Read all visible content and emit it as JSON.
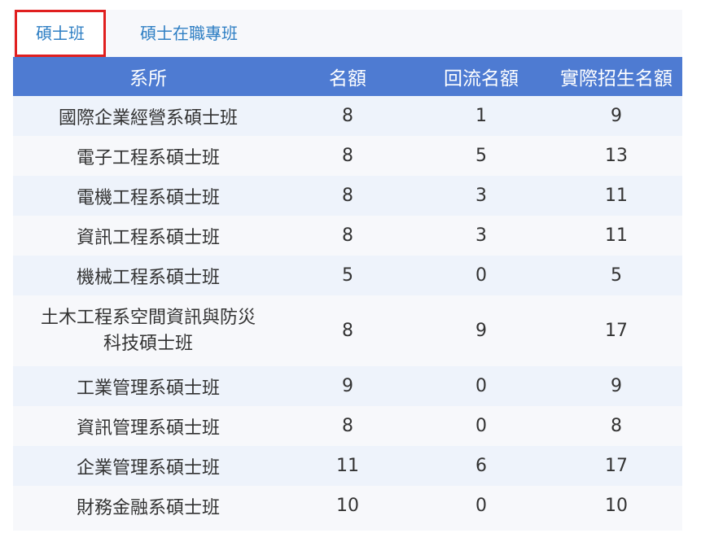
{
  "tabs": [
    {
      "label": "碩士班",
      "active": true
    },
    {
      "label": "碩士在職專班",
      "active": false
    }
  ],
  "table": {
    "headers": [
      "系所",
      "名額",
      "回流名額",
      "實際招生名額"
    ],
    "rows": [
      {
        "dept": "國際企業經營系碩士班",
        "quota": "8",
        "return_quota": "1",
        "actual": "9"
      },
      {
        "dept": "電子工程系碩士班",
        "quota": "8",
        "return_quota": "5",
        "actual": "13"
      },
      {
        "dept": "電機工程系碩士班",
        "quota": "8",
        "return_quota": "3",
        "actual": "11"
      },
      {
        "dept": "資訊工程系碩士班",
        "quota": "8",
        "return_quota": "3",
        "actual": "11"
      },
      {
        "dept": "機械工程系碩士班",
        "quota": "5",
        "return_quota": "0",
        "actual": "5"
      },
      {
        "dept": "土木工程系空間資訊與防災科技碩士班",
        "dept_line1": "土木工程系空間資訊與防災",
        "dept_line2": "科技碩士班",
        "quota": "8",
        "return_quota": "9",
        "actual": "17"
      },
      {
        "dept": "工業管理系碩士班",
        "quota": "9",
        "return_quota": "0",
        "actual": "9"
      },
      {
        "dept": "資訊管理系碩士班",
        "quota": "8",
        "return_quota": "0",
        "actual": "8"
      },
      {
        "dept": "企業管理系碩士班",
        "quota": "11",
        "return_quota": "6",
        "actual": "17"
      },
      {
        "dept": "財務金融系碩士班",
        "quota": "10",
        "return_quota": "0",
        "actual": "10"
      }
    ]
  },
  "colors": {
    "header_bg": "#4e7bd2",
    "tab_text": "#2f7fc4",
    "active_tab_border": "#e01f1f",
    "row_alt_bg": "#eef3fb"
  }
}
